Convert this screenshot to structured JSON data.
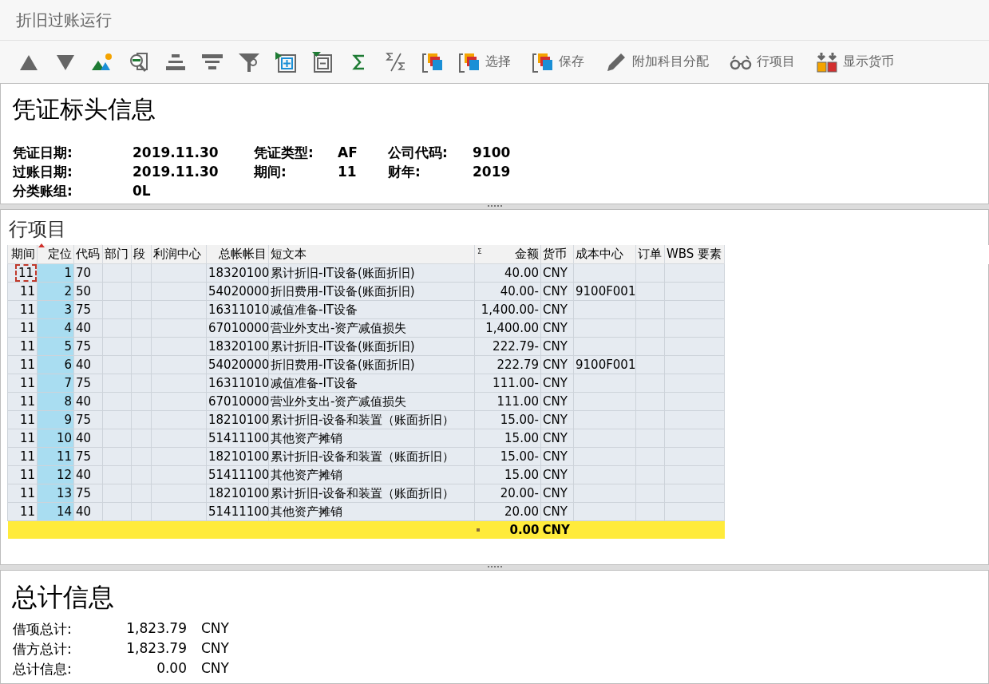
{
  "window": {
    "title": "折旧过账运行"
  },
  "toolbar": {
    "buttons": [
      {
        "kind": "sort-up"
      },
      {
        "kind": "sort-down"
      },
      {
        "kind": "picture"
      },
      {
        "kind": "find"
      },
      {
        "kind": "center"
      },
      {
        "kind": "filter-lines"
      },
      {
        "kind": "filter"
      },
      {
        "kind": "expand"
      },
      {
        "kind": "collapse"
      },
      {
        "kind": "sum"
      },
      {
        "kind": "subtotal"
      },
      {
        "kind": "layout"
      },
      {
        "kind": "layout",
        "label": "选择"
      },
      {
        "kind": "save-layout",
        "label": "保存"
      },
      {
        "kind": "pencil",
        "label": "附加科目分配"
      },
      {
        "kind": "glasses",
        "label": "行项目"
      },
      {
        "kind": "currency",
        "label": "显示货币"
      }
    ]
  },
  "header": {
    "title": "凭证标头信息",
    "rows": [
      [
        {
          "label": "凭证日期:",
          "value": "2019.11.30"
        },
        {
          "label": "凭证类型:",
          "value": "AF"
        },
        {
          "label": "公司代码:",
          "value": "9100"
        }
      ],
      [
        {
          "label": "过账日期:",
          "value": "2019.11.30"
        },
        {
          "label": "期间:",
          "value": "11"
        },
        {
          "label": "财年:",
          "value": "2019"
        }
      ],
      [
        {
          "label": "分类账组:",
          "value": "0L"
        }
      ]
    ]
  },
  "items": {
    "title": "行项目",
    "columns": [
      {
        "label": "期间",
        "key": false,
        "sorted": false
      },
      {
        "label": "定位",
        "key": true,
        "sorted": true
      },
      {
        "label": "代码",
        "key": false,
        "sorted": false
      },
      {
        "label": "部门",
        "key": false,
        "sorted": false
      },
      {
        "label": "段",
        "key": false,
        "sorted": false
      },
      {
        "label": "利润中心",
        "key": false,
        "sorted": false
      },
      {
        "label": "总帐帐目",
        "key": false,
        "sorted": false
      },
      {
        "label": "短文本",
        "key": false,
        "sorted": false
      },
      {
        "label": "金额",
        "key": false,
        "sorted": false,
        "sum_mark": "Σ"
      },
      {
        "label": "货币",
        "key": false,
        "sorted": false
      },
      {
        "label": "成本中心",
        "key": false,
        "sorted": false
      },
      {
        "label": "订单",
        "key": false,
        "sorted": false
      },
      {
        "label": "WBS 要素",
        "key": false,
        "sorted": false
      }
    ],
    "rows": [
      {
        "focused": true,
        "cells": [
          "11",
          "1",
          "70",
          "",
          "",
          "",
          "18320100",
          "累计折旧-IT设备(账面折旧)",
          "40.00",
          "CNY",
          "",
          "",
          ""
        ]
      },
      {
        "focused": false,
        "cells": [
          "11",
          "2",
          "50",
          "",
          "",
          "",
          "54020000",
          "折旧费用-IT设备(账面折旧)",
          "40.00-",
          "CNY",
          "9100F001",
          "",
          ""
        ]
      },
      {
        "focused": false,
        "cells": [
          "11",
          "3",
          "75",
          "",
          "",
          "",
          "16311010",
          "减值准备-IT设备",
          "1,400.00-",
          "CNY",
          "",
          "",
          ""
        ]
      },
      {
        "focused": false,
        "cells": [
          "11",
          "4",
          "40",
          "",
          "",
          "",
          "67010000",
          "营业外支出-资产减值损失",
          "1,400.00",
          "CNY",
          "",
          "",
          ""
        ]
      },
      {
        "focused": false,
        "cells": [
          "11",
          "5",
          "75",
          "",
          "",
          "",
          "18320100",
          "累计折旧-IT设备(账面折旧)",
          "222.79-",
          "CNY",
          "",
          "",
          ""
        ]
      },
      {
        "focused": false,
        "cells": [
          "11",
          "6",
          "40",
          "",
          "",
          "",
          "54020000",
          "折旧费用-IT设备(账面折旧)",
          "222.79",
          "CNY",
          "9100F001",
          "",
          ""
        ]
      },
      {
        "focused": false,
        "cells": [
          "11",
          "7",
          "75",
          "",
          "",
          "",
          "16311010",
          "减值准备-IT设备",
          "111.00-",
          "CNY",
          "",
          "",
          ""
        ]
      },
      {
        "focused": false,
        "cells": [
          "11",
          "8",
          "40",
          "",
          "",
          "",
          "67010000",
          "营业外支出-资产减值损失",
          "111.00",
          "CNY",
          "",
          "",
          ""
        ]
      },
      {
        "focused": false,
        "cells": [
          "11",
          "9",
          "75",
          "",
          "",
          "",
          "18210100",
          "累计折旧-设备和装置（账面折旧）",
          "15.00-",
          "CNY",
          "",
          "",
          ""
        ]
      },
      {
        "focused": false,
        "cells": [
          "11",
          "10",
          "40",
          "",
          "",
          "",
          "51411100",
          "其他资产摊销",
          "15.00",
          "CNY",
          "",
          "",
          ""
        ]
      },
      {
        "focused": false,
        "cells": [
          "11",
          "11",
          "75",
          "",
          "",
          "",
          "18210100",
          "累计折旧-设备和装置（账面折旧）",
          "15.00-",
          "CNY",
          "",
          "",
          ""
        ]
      },
      {
        "focused": false,
        "cells": [
          "11",
          "12",
          "40",
          "",
          "",
          "",
          "51411100",
          "其他资产摊销",
          "15.00",
          "CNY",
          "",
          "",
          ""
        ]
      },
      {
        "focused": false,
        "cells": [
          "11",
          "13",
          "75",
          "",
          "",
          "",
          "18210100",
          "累计折旧-设备和装置（账面折旧）",
          "20.00-",
          "CNY",
          "",
          "",
          ""
        ]
      },
      {
        "focused": false,
        "cells": [
          "11",
          "14",
          "40",
          "",
          "",
          "",
          "51411100",
          "其他资产摊销",
          "20.00",
          "CNY",
          "",
          "",
          ""
        ]
      }
    ],
    "total": {
      "amount": "0.00",
      "currency": "CNY"
    }
  },
  "totals": {
    "title": "总计信息",
    "lines": [
      {
        "label": "借项总计:",
        "amount": "1,823.79",
        "currency": "CNY"
      },
      {
        "label": "借方总计:",
        "amount": "1,823.79",
        "currency": "CNY"
      },
      {
        "label": "总计信息:",
        "amount": "0.00",
        "currency": "CNY"
      }
    ]
  }
}
